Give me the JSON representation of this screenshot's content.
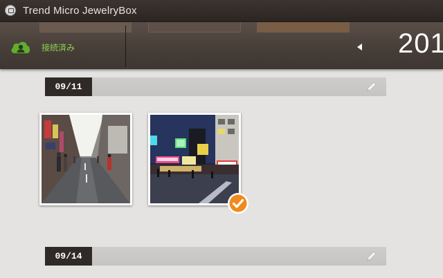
{
  "window": {
    "title": "Trend Micro JewelryBox"
  },
  "header": {
    "status": "接続済み",
    "year": "201"
  },
  "sections": [
    {
      "date": "09/11"
    },
    {
      "date": "09/14"
    }
  ],
  "photos": [
    {
      "scene": "shopping street daytime",
      "selected": false
    },
    {
      "scene": "night street with neon signs",
      "selected": true
    }
  ],
  "colors": {
    "accent_green": "#8fd14f",
    "check_orange": "#f08a1c",
    "date_label_bg": "#2f2a27"
  }
}
